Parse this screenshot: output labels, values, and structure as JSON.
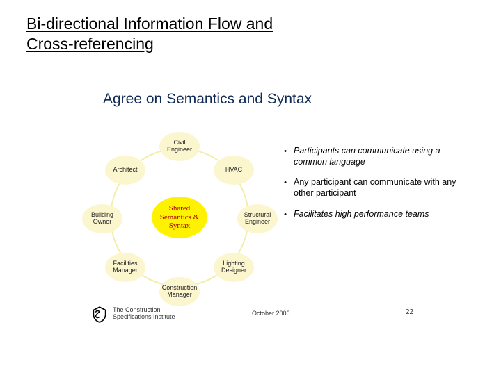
{
  "header": {
    "title_line1": "Bi-directional Information Flow and",
    "title_line2": "Cross-referencing"
  },
  "slide": {
    "subtitle": "Agree on Semantics and Syntax"
  },
  "diagram": {
    "center": "Shared Semantics & Syntax",
    "nodes": [
      "Civil Engineer",
      "HVAC",
      "Structural Engineer",
      "Lighting Designer",
      "Construction Manager",
      "Facilities Manager",
      "Building Owner",
      "Architect"
    ]
  },
  "bullets": [
    {
      "text": "Participants can communicate using a common language",
      "italic": true
    },
    {
      "text": "Any participant can communicate with any other participant",
      "italic": false
    },
    {
      "text": "Facilitates high performance teams",
      "italic": true
    }
  ],
  "footer": {
    "org_line1": "The Construction",
    "org_line2": "Specifications Institute",
    "date": "October 2006",
    "page": "22"
  }
}
